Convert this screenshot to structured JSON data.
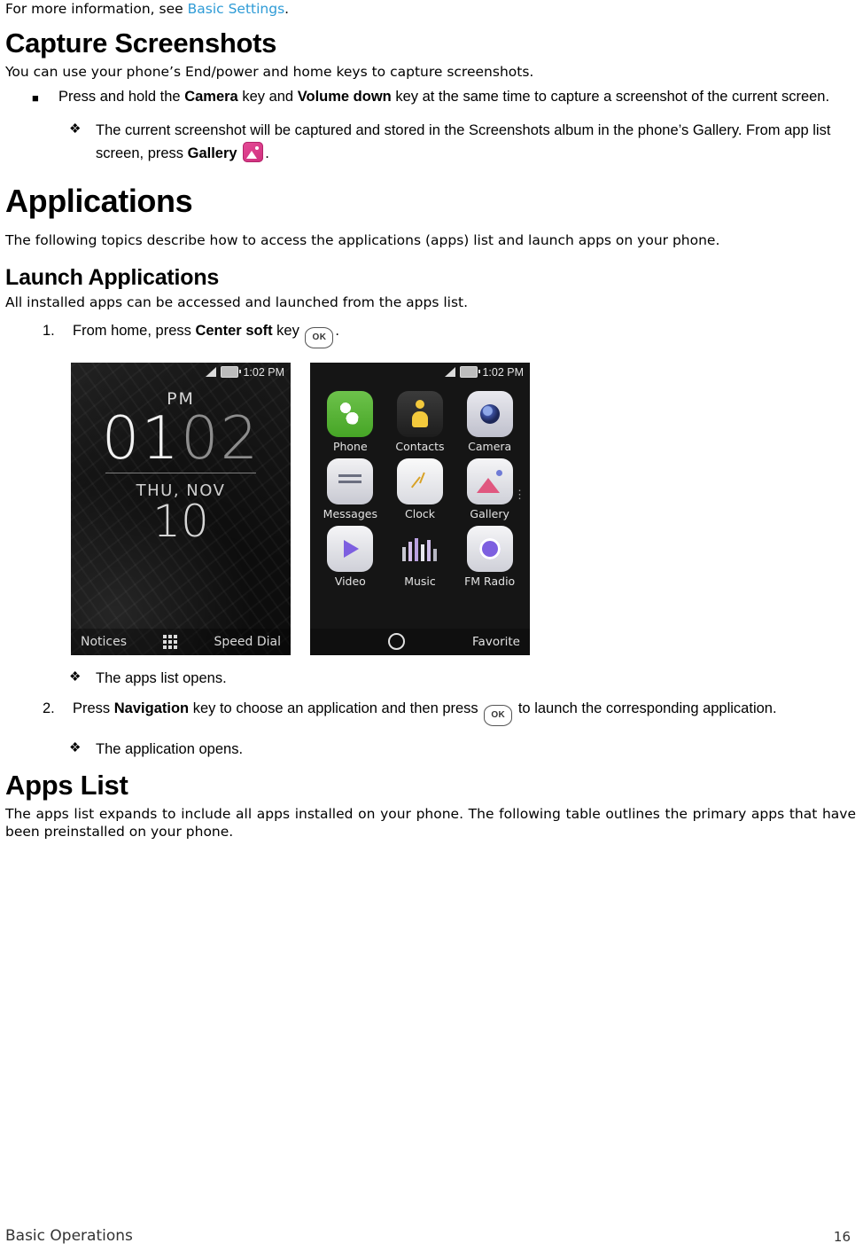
{
  "doc": {
    "intro_line": {
      "prefix": "For more information, see ",
      "link": "Basic Settings",
      "suffix": "."
    },
    "section_capture": {
      "heading": "Capture Screenshots",
      "lead": "You can use your phone’s End/power and home keys to capture screenshots.",
      "bullet": {
        "marker": "■",
        "text_parts": [
          "Press and hold the ",
          "Camera",
          " key and ",
          "Volume down",
          " key at the same time to capture a screenshot of the current screen."
        ]
      },
      "result": {
        "marker": "❖",
        "text_1": "The current screenshot will be captured and stored in the Screenshots album in the phone’s Gallery. From app list screen, press ",
        "bold_1": "Gallery",
        "icon": "gallery-icon",
        "text_2": "."
      }
    },
    "section_applications": {
      "heading": "Applications",
      "lead": "The following topics describe how to access the applications (apps) list and launch apps on your phone."
    },
    "section_launch": {
      "heading": "Launch Applications",
      "lead": "All installed apps can be accessed and launched from the apps list.",
      "step1": {
        "number": "1.",
        "text_1": "From home, press ",
        "bold_1": "Center soft",
        "text_2": " key ",
        "key": "OK",
        "text_3": "."
      },
      "result1": {
        "marker": "❖",
        "text": "The apps list opens."
      },
      "step2": {
        "number": "2.",
        "text_1": "Press ",
        "bold_1": "Navigation",
        "text_2": " key to choose an application and then press ",
        "key": "OK",
        "text_3": " to launch the corresponding application."
      },
      "result2": {
        "marker": "❖",
        "text": "The application opens."
      }
    },
    "section_apps_list": {
      "heading": "Apps List",
      "lead": "The apps list expands to include all apps installed on your phone. The following table outlines the primary apps that have been preinstalled on your phone."
    },
    "footer": {
      "left": "Basic Operations",
      "right": "16"
    }
  },
  "screenshots": {
    "home": {
      "status_time": "1:02 PM",
      "pm_label": "PM",
      "time_first": "01",
      "time_second": "02",
      "date": "THU, NOV",
      "day": "10",
      "soft_left": "Notices",
      "soft_right": "Speed Dial"
    },
    "apps": {
      "status_time": "1:02 PM",
      "items": [
        {
          "label": "Phone",
          "icon": "phone-icon"
        },
        {
          "label": "Contacts",
          "icon": "contacts-icon"
        },
        {
          "label": "Camera",
          "icon": "camera-icon"
        },
        {
          "label": "Messages",
          "icon": "messages-icon"
        },
        {
          "label": "Clock",
          "icon": "clock-icon"
        },
        {
          "label": "Gallery",
          "icon": "gallery-icon"
        },
        {
          "label": "Video",
          "icon": "video-icon"
        },
        {
          "label": "Music",
          "icon": "music-icon"
        },
        {
          "label": "FM Radio",
          "icon": "fm-radio-icon"
        }
      ],
      "soft_right": "Favorite"
    }
  },
  "colors": {
    "link": "#2e9bd6",
    "gallery_icon": "#e54b97"
  }
}
